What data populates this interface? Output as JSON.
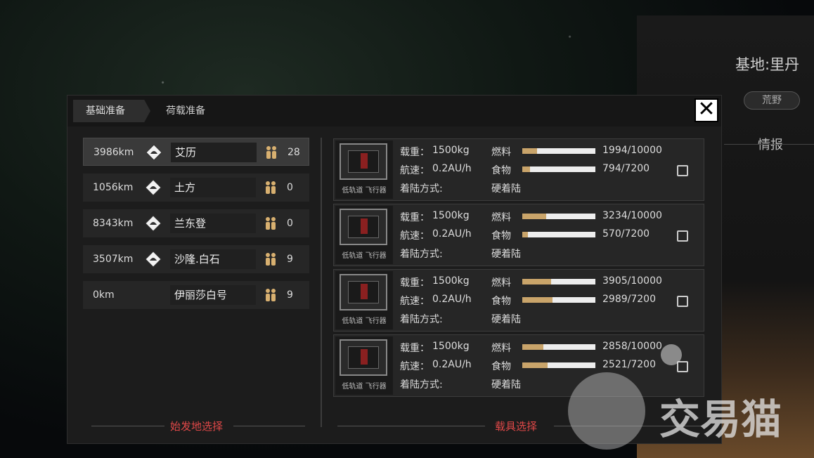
{
  "side_panel": {
    "base_title": "基地:里丹",
    "terrain": "荒野",
    "intel_tab": "情报"
  },
  "tabs": [
    {
      "label": "基础准备",
      "active": true
    },
    {
      "label": "荷载准备",
      "active": false
    }
  ],
  "close_icon": "✕",
  "origins": [
    {
      "distance": "3986km",
      "name": "艾历",
      "count": "28",
      "icon": "diamond-dome-icon",
      "selected": true
    },
    {
      "distance": "1056km",
      "name": "土方",
      "count": "0",
      "icon": "diamond-mountain-icon",
      "selected": false
    },
    {
      "distance": "8343km",
      "name": "兰东登",
      "count": "0",
      "icon": "diamond-drop-icon",
      "selected": false
    },
    {
      "distance": "3507km",
      "name": "沙隆.白石",
      "count": "9",
      "icon": "diamond-dome-icon",
      "selected": false
    },
    {
      "distance": "0km",
      "name": "伊丽莎白号",
      "count": "9",
      "icon": "",
      "selected": false
    }
  ],
  "origin_section_label": "始发地选择",
  "vehicle_section_label": "载具选择",
  "vehicles": [
    {
      "caption": "低轨道 飞行器",
      "load_label": "载重：",
      "load": "1500kg",
      "speed_label": "航速：",
      "speed": "0.2AU/h",
      "landing_label": "着陆方式:",
      "landing": "硬着陆",
      "fuel_label": "燃料",
      "fuel": "1994/10000",
      "fuel_ratio": 0.1994,
      "food_label": "食物",
      "food": "794/7200",
      "food_ratio": 0.11
    },
    {
      "caption": "低轨道 飞行器",
      "load_label": "载重：",
      "load": "1500kg",
      "speed_label": "航速：",
      "speed": "0.2AU/h",
      "landing_label": "着陆方式:",
      "landing": "硬着陆",
      "fuel_label": "燃料",
      "fuel": "3234/10000",
      "fuel_ratio": 0.3234,
      "food_label": "食物",
      "food": "570/7200",
      "food_ratio": 0.079
    },
    {
      "caption": "低轨道 飞行器",
      "load_label": "载重：",
      "load": "1500kg",
      "speed_label": "航速：",
      "speed": "0.2AU/h",
      "landing_label": "着陆方式:",
      "landing": "硬着陆",
      "fuel_label": "燃料",
      "fuel": "3905/10000",
      "fuel_ratio": 0.3905,
      "food_label": "食物",
      "food": "2989/7200",
      "food_ratio": 0.415
    },
    {
      "caption": "低轨道 飞行器",
      "load_label": "载重：",
      "load": "1500kg",
      "speed_label": "航速：",
      "speed": "0.2AU/h",
      "landing_label": "着陆方式:",
      "landing": "硬着陆",
      "fuel_label": "燃料",
      "fuel": "2858/10000",
      "fuel_ratio": 0.2858,
      "food_label": "食物",
      "food": "2521/7200",
      "food_ratio": 0.35
    }
  ],
  "watermark": "交易猫",
  "colors": {
    "accent_red": "#e04848",
    "bar_fill": "#c9a46a",
    "people_icon": "#d8b070"
  }
}
